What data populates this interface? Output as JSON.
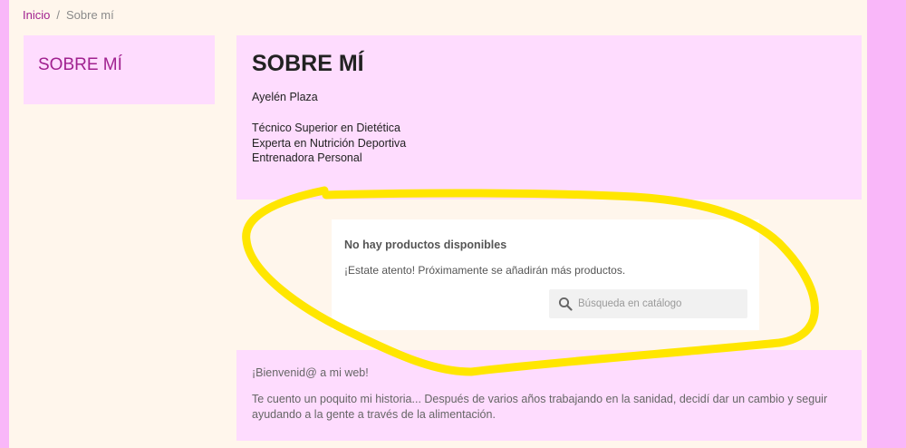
{
  "breadcrumb": {
    "home": "Inicio",
    "separator": "/",
    "current": "Sobre mí"
  },
  "sidebar": {
    "title": "SOBRE MÍ"
  },
  "content": {
    "title": "SOBRE MÍ",
    "author": "Ayelén Plaza",
    "roles": [
      "Técnico  Superior en Dietética",
      "Experta en Nutrición Deportiva",
      "Entrenadora Personal"
    ]
  },
  "products": {
    "title": "No hay productos disponibles",
    "note": "¡Estate atento! Próximamente se añadirán más productos.",
    "search_placeholder": "Búsqueda en catálogo"
  },
  "welcome": {
    "title": "¡Bienvenid@ a mi web!",
    "text": "Te cuento un poquito mi historia... Después de varios años trabajando en la sanidad, decidí dar un cambio y seguir ayudando a la gente a través de la alimentación."
  },
  "colors": {
    "outer_background": "#f9b7f9",
    "page_background": "#fff6ec",
    "panel_background": "#fedcfe",
    "accent": "#a0218f",
    "annotation": "#ffe600"
  },
  "icons": {
    "search": "search-icon"
  }
}
